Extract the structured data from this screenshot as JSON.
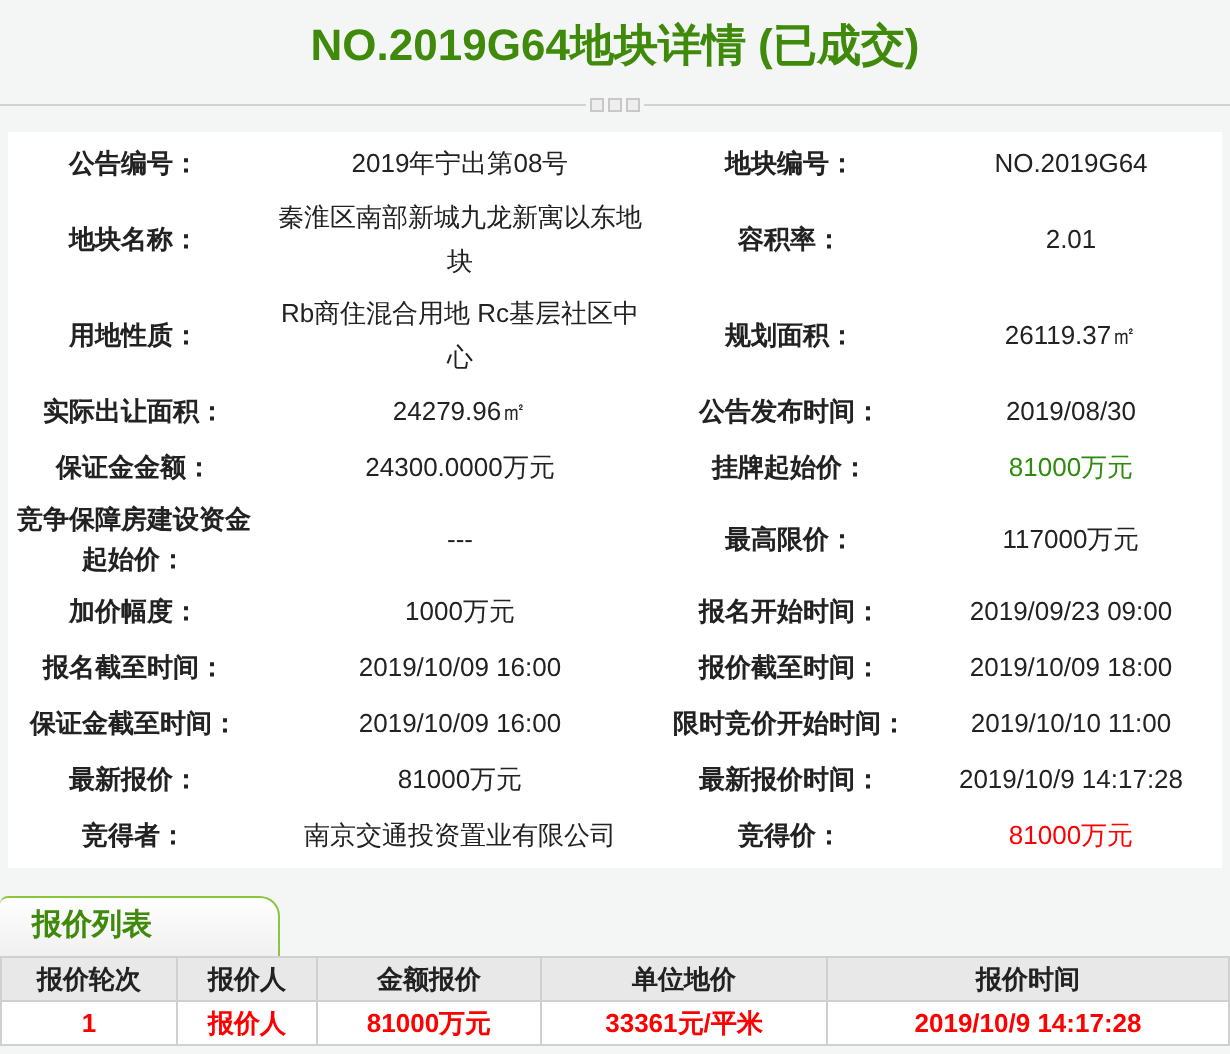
{
  "title": "NO.2019G64地块详情 (已成交)",
  "rows": [
    [
      {
        "label": "公告编号：",
        "value": "2019年宁出第08号"
      },
      {
        "label": "地块编号：",
        "value": "NO.2019G64"
      }
    ],
    [
      {
        "label": "地块名称：",
        "value": "秦淮区南部新城九龙新寓以东地块"
      },
      {
        "label": "容积率：",
        "value": "2.01"
      }
    ],
    [
      {
        "label": "用地性质：",
        "value": "Rb商住混合用地 Rc基层社区中心"
      },
      {
        "label": "规划面积：",
        "value": "26119.37㎡"
      }
    ],
    [
      {
        "label": "实际出让面积：",
        "value": "24279.96㎡"
      },
      {
        "label": "公告发布时间：",
        "value": "2019/08/30"
      }
    ],
    [
      {
        "label": "保证金金额：",
        "value": "24300.0000万元"
      },
      {
        "label": "挂牌起始价：",
        "value": "81000万元",
        "color": "#2e8b0e"
      }
    ],
    [
      {
        "label": "竞争保障房建设资金起始价：",
        "value": "---"
      },
      {
        "label": "最高限价：",
        "value": "117000万元"
      }
    ],
    [
      {
        "label": "加价幅度：",
        "value": "1000万元"
      },
      {
        "label": "报名开始时间：",
        "value": "2019/09/23 09:00"
      }
    ],
    [
      {
        "label": "报名截至时间：",
        "value": "2019/10/09 16:00"
      },
      {
        "label": "报价截至时间：",
        "value": "2019/10/09 18:00"
      }
    ],
    [
      {
        "label": "保证金截至时间：",
        "value": "2019/10/09 16:00"
      },
      {
        "label": "限时竞价开始时间：",
        "value": "2019/10/10 11:00"
      }
    ],
    [
      {
        "label": "最新报价：",
        "value": "81000万元"
      },
      {
        "label": "最新报价时间：",
        "value": "2019/10/9 14:17:28"
      }
    ],
    [
      {
        "label": "竞得者：",
        "value": "南京交通投资置业有限公司"
      },
      {
        "label": "竞得价：",
        "value": "81000万元",
        "color": "#ff0000"
      }
    ]
  ],
  "bid_list": {
    "tab": "报价列表",
    "columns": [
      "报价轮次",
      "报价人",
      "金额报价",
      "单位地价",
      "报价时间"
    ],
    "rows": [
      [
        "1",
        "报价人",
        "81000万元",
        "33361元/平米",
        "2019/10/9 14:17:28"
      ]
    ]
  }
}
